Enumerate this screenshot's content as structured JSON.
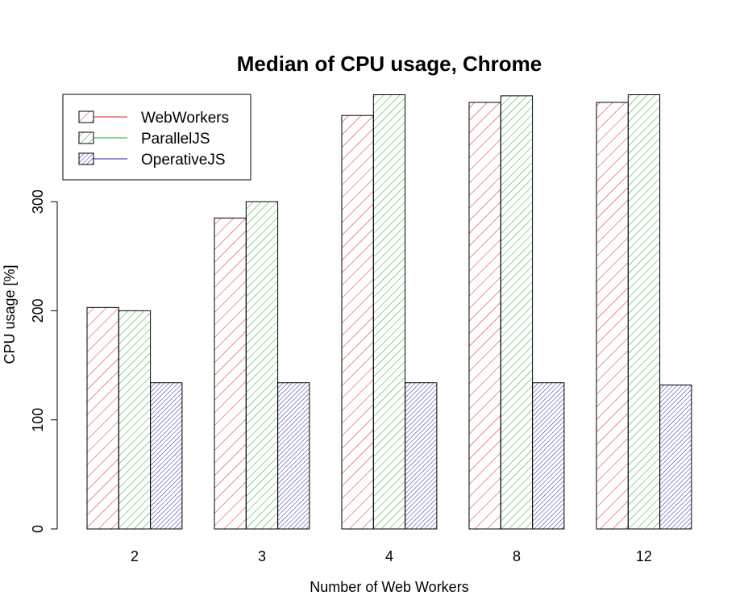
{
  "chart_data": {
    "type": "bar",
    "title": "Median of CPU usage, Chrome",
    "xlabel": "Number of Web Workers",
    "ylabel": "CPU usage [%]",
    "categories": [
      "2",
      "3",
      "4",
      "8",
      "12"
    ],
    "series": [
      {
        "name": "WebWorkers",
        "color": "#dd2222",
        "hatch": "right",
        "values": [
          203,
          285,
          379,
          391,
          391
        ]
      },
      {
        "name": "ParallelJS",
        "color": "#22aa22",
        "hatch": "right",
        "values": [
          200,
          300,
          398,
          397,
          398
        ]
      },
      {
        "name": "OperativeJS",
        "color": "#2222aa",
        "hatch": "dense",
        "values": [
          134,
          134,
          134,
          134,
          132
        ]
      }
    ],
    "yticks": [
      0,
      100,
      200,
      300
    ],
    "ylim": [
      0,
      400
    ],
    "grid": false,
    "legend_position": "top-left"
  }
}
